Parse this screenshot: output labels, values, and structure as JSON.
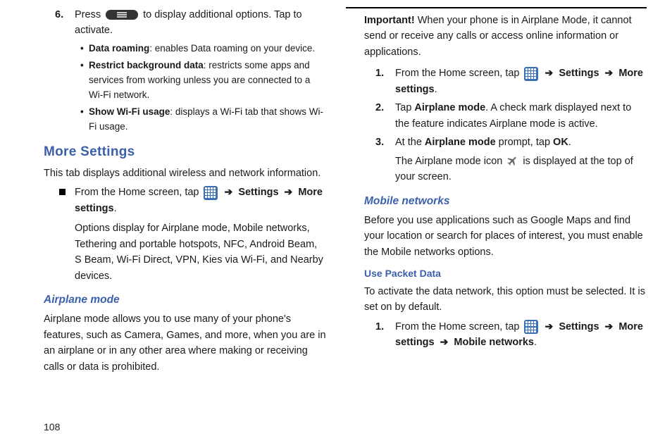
{
  "left": {
    "step6": {
      "num": "6.",
      "text_before": "Press ",
      "text_after": " to display additional options. Tap to activate."
    },
    "bullets": [
      {
        "bold": "Data roaming",
        "text": ": enables Data roaming on your device."
      },
      {
        "bold": "Restrict background data",
        "text": ": restricts some apps and services from working unless you are connected to a Wi-Fi network."
      },
      {
        "bold": "Show Wi-Fi usage",
        "text": ": displays a Wi-Fi tab that shows Wi-Fi usage."
      }
    ],
    "more_settings_heading": "More Settings",
    "more_settings_intro": "This tab displays additional wireless and network information.",
    "square": {
      "pre": "From the Home screen, tap ",
      "settings": "Settings",
      "more": "More settings",
      "options_text": "Options display for Airplane mode, Mobile networks, Tethering and portable hotspots, NFC, Android Beam, S Beam, Wi-Fi Direct, VPN, Kies via Wi-Fi, and Nearby devices."
    },
    "airplane_heading": "Airplane mode",
    "airplane_para": "Airplane mode allows you to use many of your phone's features, such as Camera, Games, and more, when you are in an airplane or in any other area where making or receiving calls or data is prohibited.",
    "page_number": "108"
  },
  "right": {
    "important_label": "Important!",
    "important_text": " When your phone is in Airplane Mode, it cannot send or receive any calls or access online information or applications.",
    "steps": [
      {
        "num": "1.",
        "pre": "From the Home screen, tap ",
        "settings": "Settings",
        "more": "More settings"
      },
      {
        "num": "2.",
        "tap": "Tap ",
        "bold": "Airplane mode",
        "post": ". A check mark displayed next to the feature indicates Airplane mode is active."
      },
      {
        "num": "3.",
        "at": "At the ",
        "bold1": "Airplane mode",
        "mid": " prompt, tap ",
        "bold2": "OK",
        "end": "."
      }
    ],
    "plane_icon_text_pre": "The Airplane mode icon ",
    "plane_icon_text_post": " is displayed at the top of your screen.",
    "mobile_heading": "Mobile networks",
    "mobile_para": "Before you use applications such as Google Maps and find your location or search for places of interest, you must enable the Mobile networks options.",
    "packet_heading": "Use Packet Data",
    "packet_para": "To activate the data network, this option must be selected. It is set on by default.",
    "packet_step": {
      "num": "1.",
      "pre": "From the Home screen, tap ",
      "settings": "Settings",
      "more": "More settings",
      "mobile": "Mobile networks"
    }
  },
  "arrow": "➔"
}
